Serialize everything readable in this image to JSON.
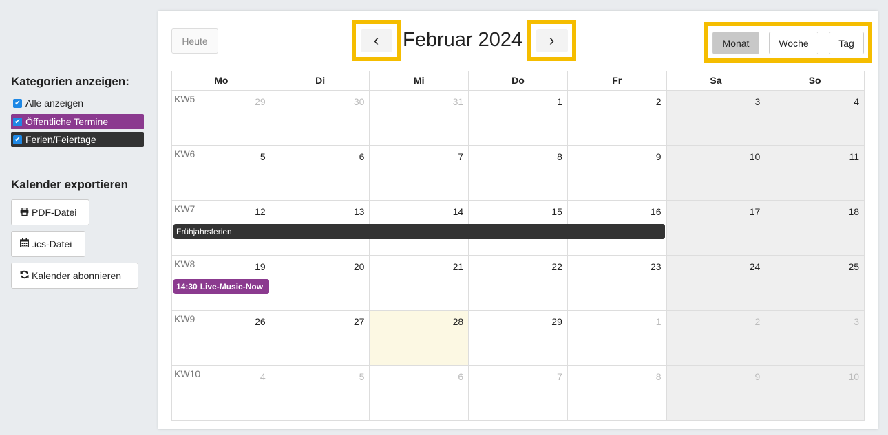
{
  "sidebar": {
    "categories_title": "Kategorien anzeigen:",
    "categories": [
      {
        "label": "Alle anzeigen",
        "checked": true
      },
      {
        "label": "Öffentliche Termine",
        "checked": true,
        "color": "#8b3a8f"
      },
      {
        "label": "Ferien/Feiertage",
        "checked": true,
        "color": "#333333"
      }
    ],
    "export_title": "Kalender exportieren",
    "buttons": {
      "pdf": "PDF-Datei",
      "ics": ".ics-Datei",
      "subscribe": "Kalender abonnieren"
    }
  },
  "toolbar": {
    "today": "Heute",
    "prev": "‹",
    "next": "›",
    "title": "Februar 2024",
    "views": {
      "month": "Monat",
      "week": "Woche",
      "day": "Tag"
    },
    "active_view": "Monat",
    "highlight_color": "#f5bd00"
  },
  "calendar": {
    "weekdays": [
      "Mo",
      "Di",
      "Mi",
      "Do",
      "Fr",
      "Sa",
      "So"
    ],
    "weeks": [
      {
        "kw": "KW5",
        "days": [
          "29",
          "30",
          "31",
          "1",
          "2",
          "3",
          "4"
        ]
      },
      {
        "kw": "KW6",
        "days": [
          "5",
          "6",
          "7",
          "8",
          "9",
          "10",
          "11"
        ]
      },
      {
        "kw": "KW7",
        "days": [
          "12",
          "13",
          "14",
          "15",
          "16",
          "17",
          "18"
        ]
      },
      {
        "kw": "KW8",
        "days": [
          "19",
          "20",
          "21",
          "22",
          "23",
          "24",
          "25"
        ]
      },
      {
        "kw": "KW9",
        "days": [
          "26",
          "27",
          "28",
          "29",
          "1",
          "2",
          "3"
        ]
      },
      {
        "kw": "KW10",
        "days": [
          "4",
          "5",
          "6",
          "7",
          "8",
          "9",
          "10"
        ]
      }
    ],
    "today_date": "28",
    "events": {
      "ferien": {
        "title": "Frühjahrsferien",
        "color": "#333333"
      },
      "music": {
        "time": "14:30",
        "title": "Live-Music-Now",
        "color": "#8b3a8f"
      }
    }
  }
}
